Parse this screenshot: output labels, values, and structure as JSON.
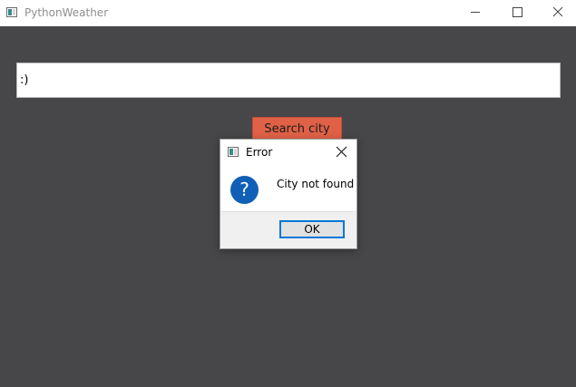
{
  "window": {
    "title": "PythonWeather"
  },
  "main": {
    "city_input_value": ":)",
    "search_button_label": "Search city"
  },
  "dialog": {
    "title": "Error",
    "icon": "question-icon",
    "icon_glyph": "?",
    "message": "City not found",
    "ok_label": "OK"
  },
  "colors": {
    "background": "#474749",
    "search_button": "#e06146",
    "ok_border": "#0078d7",
    "question_icon": "#1060b8"
  }
}
